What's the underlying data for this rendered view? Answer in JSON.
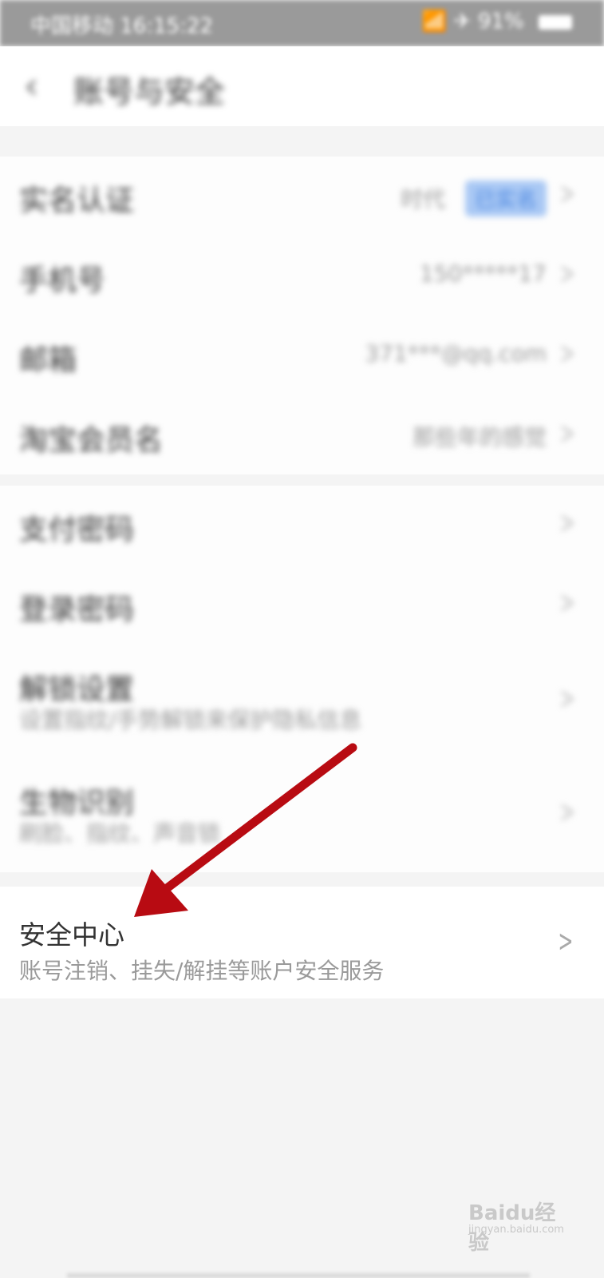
{
  "status_bar": {
    "left_text": "中国移动 16:15:22",
    "right_text": "📶 ✈ 91%"
  },
  "header": {
    "title": "账号与安全"
  },
  "account_rows": [
    {
      "label": "实名认证",
      "value": "时代",
      "badge": "已实名"
    },
    {
      "label": "手机号",
      "value": "150*****17"
    },
    {
      "label": "邮箱",
      "value": "371***@qq.com"
    },
    {
      "label": "淘宝会员名",
      "value": "那些年的感觉"
    }
  ],
  "security_rows": [
    {
      "label": "支付密码",
      "sub": ""
    },
    {
      "label": "登录密码",
      "sub": ""
    },
    {
      "label": "解锁设置",
      "sub": "设置指纹/手势解锁来保护隐私信息"
    },
    {
      "label": "生物识别",
      "sub": "刷脸、指纹、声音锁"
    }
  ],
  "security_center": {
    "title": "安全中心",
    "subtitle": "账号注销、挂失/解挂等账户安全服务"
  },
  "annotation": {
    "arrow_color": "#b80b12"
  },
  "watermark": {
    "text": "Baidu经验",
    "sub": "jingyan.baidu.com"
  },
  "icons": {
    "back": "chevron-left-icon",
    "chevron": "chevron-right-icon"
  }
}
